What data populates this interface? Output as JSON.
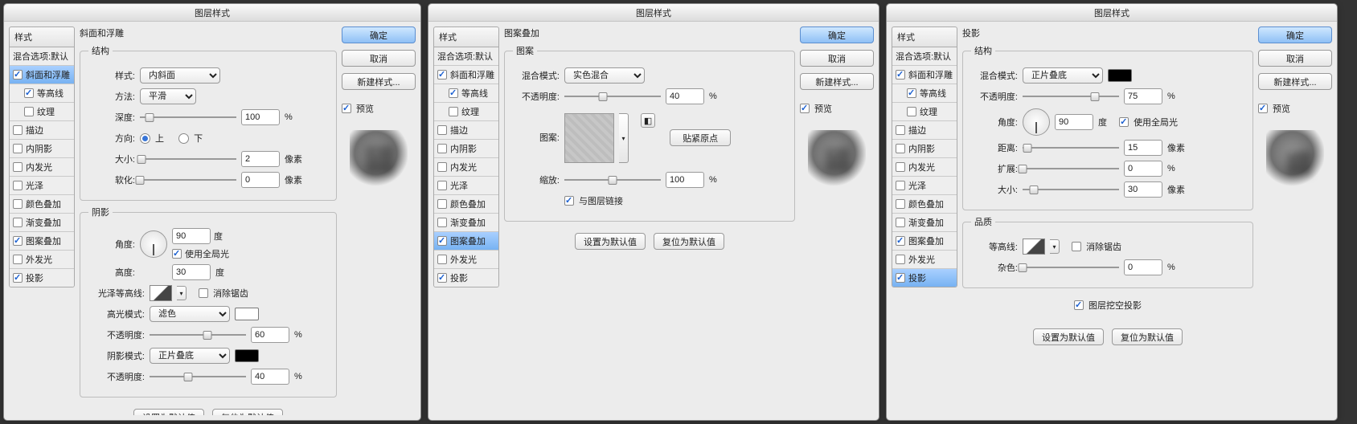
{
  "title": "图层样式",
  "buttons": {
    "ok": "确定",
    "cancel": "取消",
    "newstyle": "新建样式...",
    "preview": "预览",
    "setdefault": "设置为默认值",
    "resetdefault": "复位为默认值",
    "snap": "贴紧原点"
  },
  "stylelist": {
    "header": "样式",
    "items": [
      {
        "label": "混合选项:默认",
        "chk": false,
        "noChk": true
      },
      {
        "label": "斜面和浮雕",
        "chk": true
      },
      {
        "label": "等高线",
        "chk": true,
        "indent": true
      },
      {
        "label": "纹理",
        "chk": false,
        "indent": true
      },
      {
        "label": "描边",
        "chk": false
      },
      {
        "label": "内阴影",
        "chk": false
      },
      {
        "label": "内发光",
        "chk": false
      },
      {
        "label": "光泽",
        "chk": false
      },
      {
        "label": "颜色叠加",
        "chk": false
      },
      {
        "label": "渐变叠加",
        "chk": false
      },
      {
        "label": "图案叠加",
        "chk": true
      },
      {
        "label": "外发光",
        "chk": false
      },
      {
        "label": "投影",
        "chk": true
      }
    ]
  },
  "d1": {
    "heading": "斜面和浮雕",
    "groups": {
      "structure": "结构",
      "shading": "阴影"
    },
    "labels": {
      "style": "样式:",
      "technique": "方法:",
      "depth": "深度:",
      "direction": "方向:",
      "up": "上",
      "down": "下",
      "size": "大小:",
      "soften": "软化:",
      "angle": "角度:",
      "altitude": "高度:",
      "useGlobal": "使用全局光",
      "glossContour": "光泽等高线:",
      "antialias": "消除锯齿",
      "highlightMode": "高光模式:",
      "highlightOpacity": "不透明度:",
      "shadowMode": "阴影模式:",
      "shadowOpacity": "不透明度:",
      "px": "像素",
      "deg": "度",
      "pct": "%"
    },
    "values": {
      "style": "内斜面",
      "technique": "平滑",
      "depth": "100",
      "size": "2",
      "soften": "0",
      "angle": "90",
      "altitude": "30",
      "highlightMode": "滤色",
      "highlightOpacity": "60",
      "shadowMode": "正片叠底",
      "shadowOpacity": "40",
      "dirUp": true
    }
  },
  "d2": {
    "heading": "图案叠加",
    "groups": {
      "pattern": "图案"
    },
    "labels": {
      "blend": "混合模式:",
      "opacity": "不透明度:",
      "pattern": "图案:",
      "scale": "缩放:",
      "link": "与图层链接",
      "pct": "%"
    },
    "values": {
      "blend": "实色混合",
      "opacity": "40",
      "scale": "100",
      "link": true
    }
  },
  "d3": {
    "heading": "投影",
    "groups": {
      "structure": "结构",
      "quality": "品质"
    },
    "labels": {
      "blend": "混合模式:",
      "opacity": "不透明度:",
      "angle": "角度:",
      "useGlobal": "使用全局光",
      "distance": "距离:",
      "spread": "扩展:",
      "size": "大小:",
      "contour": "等高线:",
      "antialias": "消除锯齿",
      "noise": "杂色:",
      "knockout": "图层挖空投影",
      "px": "像素",
      "deg": "度",
      "pct": "%"
    },
    "values": {
      "blend": "正片叠底",
      "opacity": "75",
      "angle": "90",
      "distance": "15",
      "spread": "0",
      "size": "30",
      "noise": "0",
      "useGlobal": true,
      "knockout": true
    }
  }
}
